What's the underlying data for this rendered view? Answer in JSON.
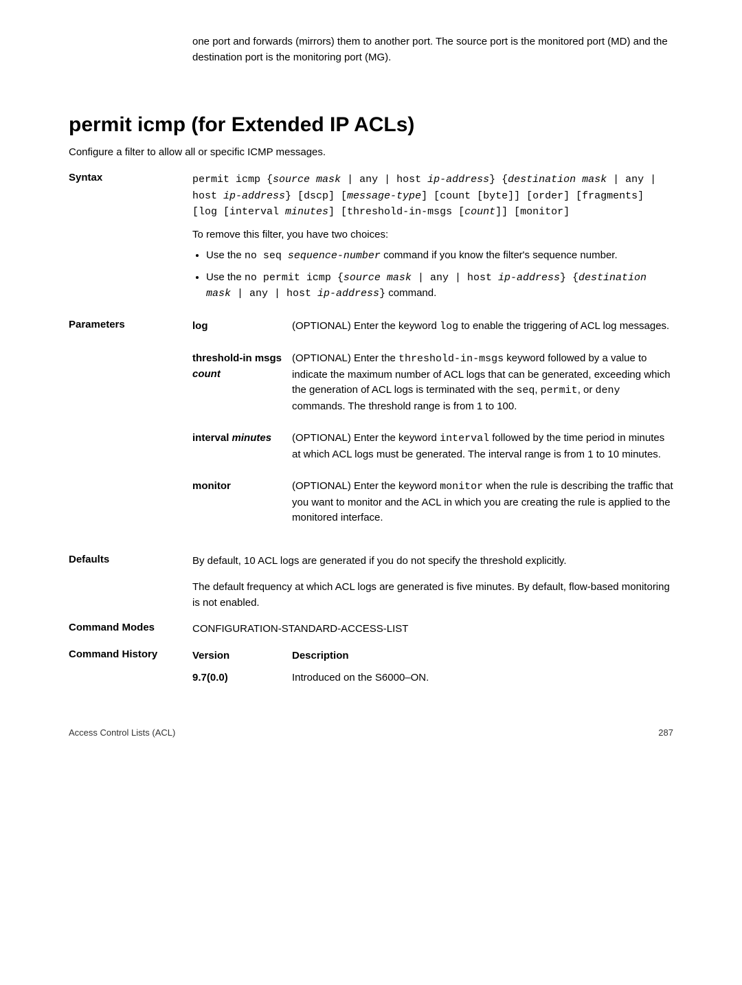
{
  "intro": "one port and forwards (mirrors) them to another port. The source port is the monitored port (MD) and the destination port is the monitoring port (MG).",
  "heading": "permit icmp (for Extended IP ACLs)",
  "subtitle": "Configure a filter to allow all or specific ICMP messages.",
  "syntax": {
    "label": "Syntax",
    "line1a": "permit icmp {",
    "line1b": "source mask",
    "line1c": " | any | host ",
    "line1d": "ip-address",
    "line1e": "} {",
    "line1f": "destination mask",
    "line1g": " | any | host ",
    "line1h": "ip-address",
    "line1i": "} [dscp] [",
    "line1j": "message-type",
    "line1k": "] [count [byte]] [order] [fragments] [log [interval ",
    "line1l": "minutes",
    "line1m": "] [threshold-in-msgs [",
    "line1n": "count",
    "line1o": "]] [monitor]",
    "remove": "To remove this filter, you have two choices:",
    "bullet1a": "Use the ",
    "bullet1b": "no seq ",
    "bullet1c": "sequence-number",
    "bullet1d": " command if you know the filter's sequence number.",
    "bullet2a": "Use the ",
    "bullet2b": "no permit icmp {",
    "bullet2c": "source mask",
    "bullet2d": " | any | host ",
    "bullet2e": "ip-address",
    "bullet2f": "} {",
    "bullet2g": "destination mask",
    "bullet2h": " | any | host ",
    "bullet2i": "ip-address",
    "bullet2j": "}",
    "bullet2k": " command."
  },
  "parameters": {
    "label": "Parameters",
    "items": [
      {
        "name": "log",
        "desc_a": "(OPTIONAL) Enter the keyword ",
        "desc_b": "log",
        "desc_c": " to enable the triggering of ACL log messages."
      },
      {
        "name": "threshold-in msgs ",
        "name_italic": "count",
        "desc_a": "(OPTIONAL) Enter the ",
        "desc_b": "threshold-in-msgs",
        "desc_c": " keyword followed by a value to indicate the maximum number of ACL logs that can be generated, exceeding which the generation of ACL logs is terminated with the ",
        "desc_d": "seq",
        "desc_e": ", ",
        "desc_f": "permit",
        "desc_g": ", or ",
        "desc_h": "deny",
        "desc_i": " commands. The threshold range is from 1 to 100."
      },
      {
        "name": "interval ",
        "name_italic": "minutes",
        "desc_a": "(OPTIONAL) Enter the keyword ",
        "desc_b": "interval",
        "desc_c": " followed by the time period in minutes at which ACL logs must be generated. The interval range is from 1 to 10 minutes."
      },
      {
        "name": "monitor",
        "desc_a": "(OPTIONAL) Enter the keyword ",
        "desc_b": "monitor",
        "desc_c": " when the rule is describing the traffic that you want to monitor and the ACL in which you are creating the rule is applied to the monitored interface."
      }
    ]
  },
  "defaults": {
    "label": "Defaults",
    "p1": "By default, 10 ACL logs are generated if you do not specify the threshold explicitly.",
    "p2": "The default frequency at which ACL logs are generated is five minutes. By default, flow-based monitoring is not enabled."
  },
  "command_modes": {
    "label": "Command Modes",
    "value": "CONFIGURATION-STANDARD-ACCESS-LIST"
  },
  "command_history": {
    "label": "Command History",
    "header_version": "Version",
    "header_desc": "Description",
    "rows": [
      {
        "version": "9.7(0.0)",
        "desc": "Introduced on the S6000–ON."
      }
    ]
  },
  "footer": {
    "left": "Access Control Lists (ACL)",
    "right": "287"
  }
}
